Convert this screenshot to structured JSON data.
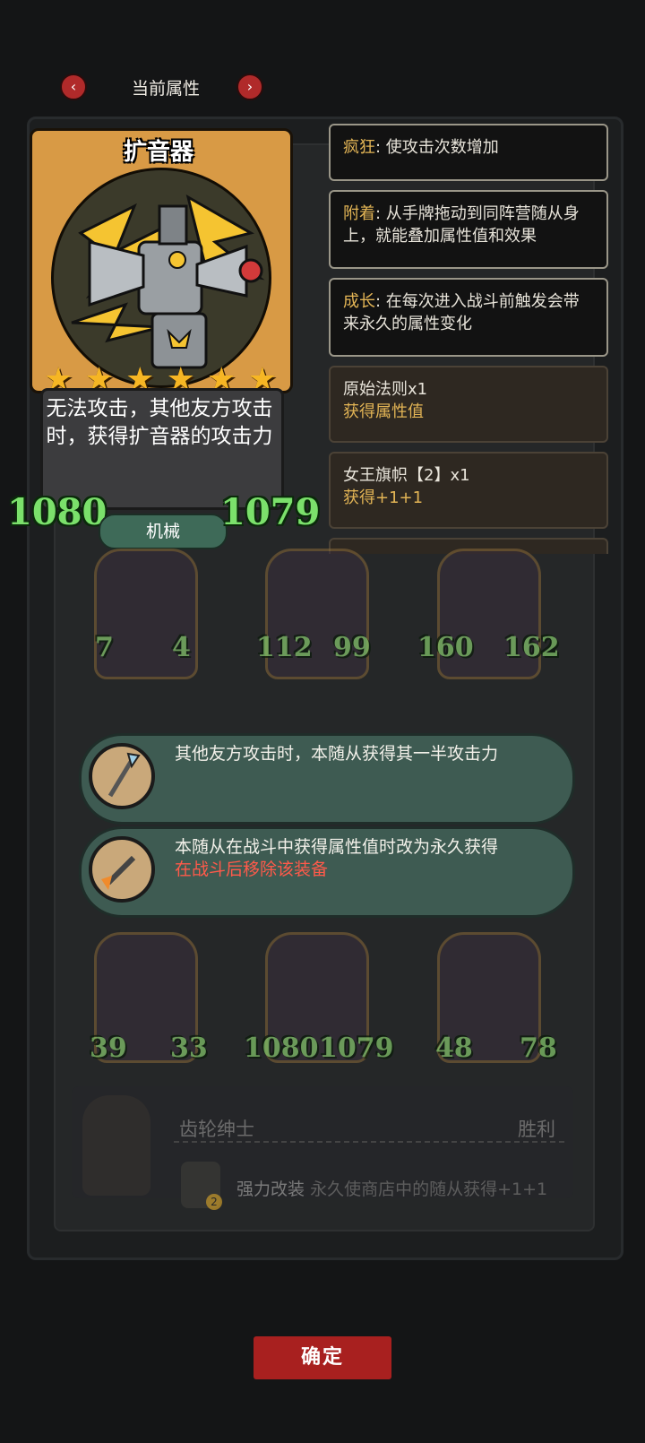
{
  "header": {
    "title": "当前属性",
    "prev_icon": "chevron-left-icon",
    "next_icon": "chevron-right-icon"
  },
  "card": {
    "name": "扩音器",
    "stars": 6,
    "star_glyph": "★",
    "description": "无法攻击，其他友方攻击时，获得扩音器的攻击力",
    "attack": "1080",
    "health": "1079",
    "tribe": "机械"
  },
  "info": [
    {
      "keyword": "疯狂",
      "text": ": 使攻击次数增加"
    },
    {
      "keyword": "附着",
      "text": ": 从手牌拖动到同阵营随从身上，就能叠加属性值和效果"
    },
    {
      "keyword": "成长",
      "text": ": 在每次进入战斗前触发会带来永久的属性变化"
    }
  ],
  "buffs": [
    {
      "title": "原始法则x1",
      "effect": "获得属性值"
    },
    {
      "title": "女王旗帜【2】x1",
      "effect": "获得+1+1"
    }
  ],
  "board": {
    "row1": [
      {
        "attack": "7",
        "health": "4"
      },
      {
        "attack": "112",
        "health": "99"
      },
      {
        "attack": "160",
        "health": "162"
      }
    ],
    "row2": [
      {
        "attack": "39",
        "health": "33"
      },
      {
        "attack": "1080",
        "health": "1079"
      },
      {
        "attack": "48",
        "health": "78"
      }
    ]
  },
  "tooltips": [
    {
      "text": "其他友方攻击时，本随从获得其一半攻击力",
      "warning": ""
    },
    {
      "text": "本随从在战斗中获得属性值时改为永久获得",
      "warning": "在战斗后移除该装备"
    }
  ],
  "gear": {
    "title": "齿轮绅士",
    "result": "胜利",
    "skill_name": "强力改装",
    "skill_desc": "永久使商店中的随从获得+1+1",
    "level": "2"
  },
  "confirm_label": "确定",
  "colors": {
    "accent": "#e2b455",
    "stat_green": "#7be06b",
    "warning": "#ff5a4a",
    "button": "#a8201f"
  }
}
